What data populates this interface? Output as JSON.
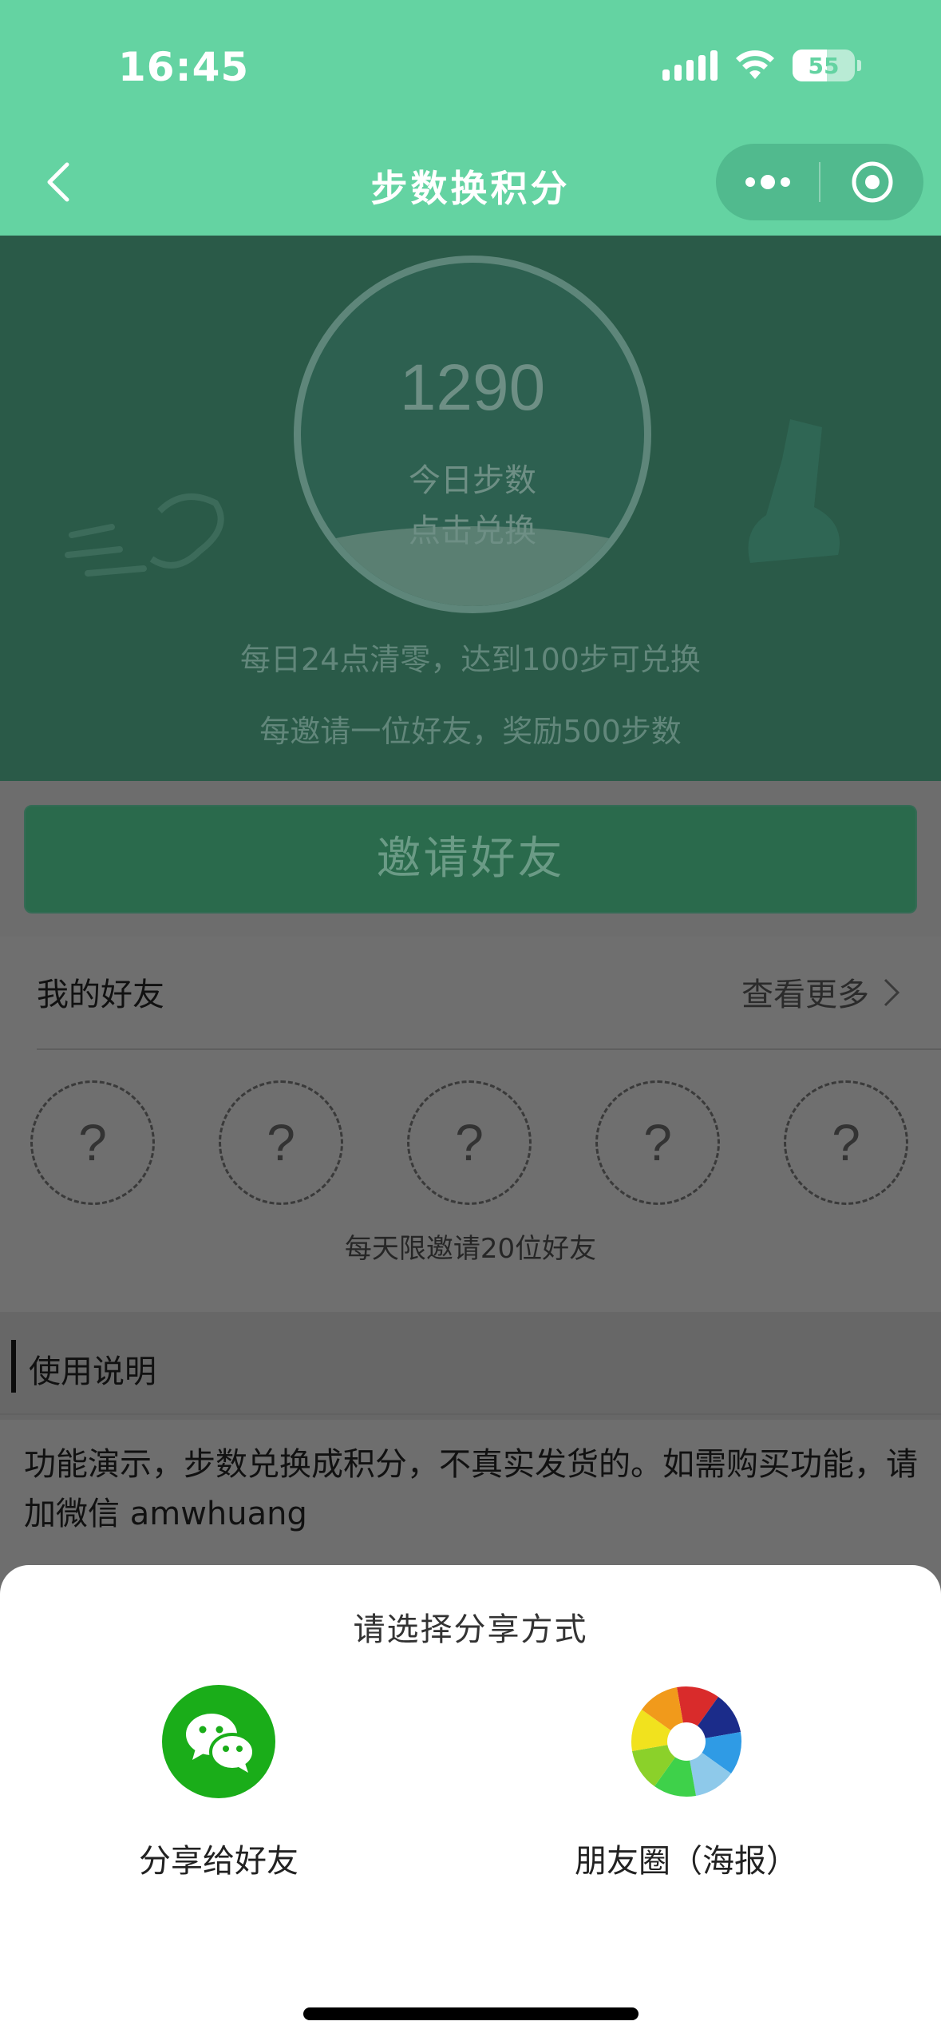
{
  "status": {
    "time": "16:45",
    "battery": "55"
  },
  "nav": {
    "title": "步数换积分"
  },
  "hero": {
    "steps": "1290",
    "steps_label": "今日步数",
    "action": "点击兑换",
    "rule_reset": "每日24点清零，达到100步可兑换",
    "rule_invite": "每邀请一位好友，奖励500步数"
  },
  "invite": {
    "button": "邀请好友"
  },
  "friends": {
    "title": "我的好友",
    "more": "查看更多",
    "slots": [
      "?",
      "?",
      "?",
      "?",
      "?"
    ],
    "limit": "每天限邀请20位好友"
  },
  "usage": {
    "title": "使用说明",
    "text": "功能演示，步数兑换成积分，不真实发货的。如需购买功能，请加微信 amwhuang"
  },
  "share_sheet": {
    "title": "请选择分享方式",
    "wechat_label": "分享给好友",
    "moments_label": "朋友圈（海报）"
  },
  "colors": {
    "brand_green": "#64d3a2",
    "hero_dark": "#2a5a48",
    "wechat_green": "#1aad19"
  },
  "icons": [
    "back-icon",
    "more-dots-icon",
    "close-target-icon",
    "chevron-right-icon",
    "wechat-icon",
    "moments-icon"
  ]
}
